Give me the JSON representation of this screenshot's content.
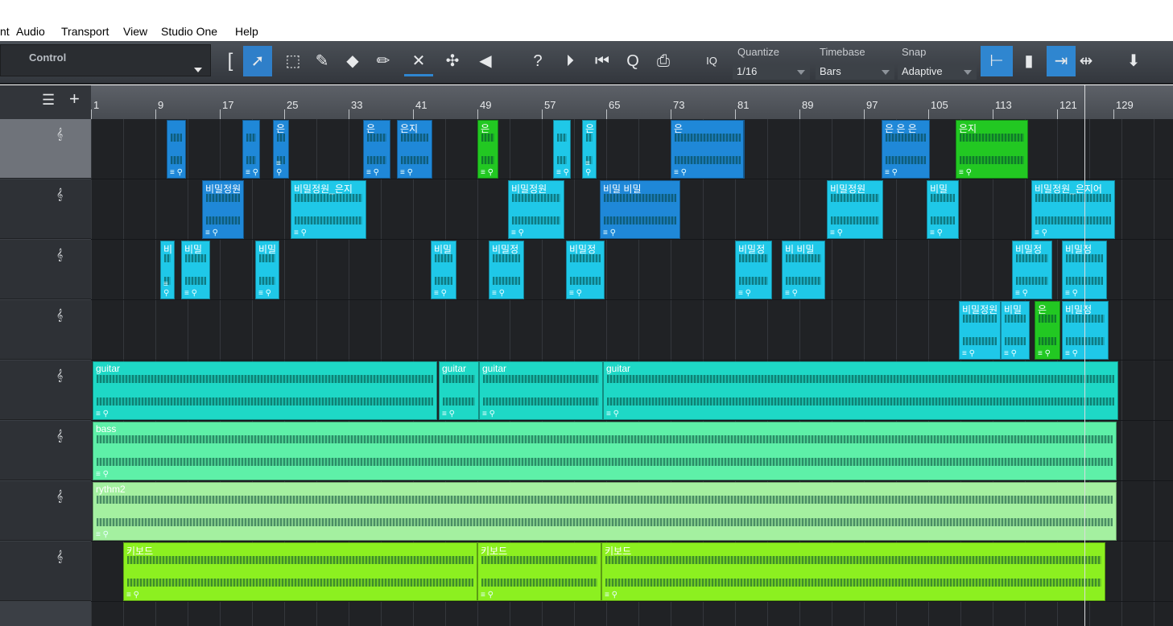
{
  "menu": [
    "nt",
    "Audio",
    "Transport",
    "View",
    "Studio One",
    "Help"
  ],
  "toolbar": {
    "control_label": "Control",
    "quantize_label": "Quantize",
    "quantize_value": "1/16",
    "timebase_label": "Timebase",
    "timebase_value": "Bars",
    "snap_label": "Snap",
    "snap_value": "Adaptive",
    "iq_label": "IQ",
    "question": "?",
    "q_label": "Q"
  },
  "ruler": [
    "1",
    "9",
    "17",
    "25",
    "33",
    "41",
    "49",
    "57",
    "65",
    "73",
    "81",
    "89",
    "97",
    "105",
    "113",
    "121",
    "129"
  ],
  "colors": {
    "blue": "#1f88d8",
    "cyan": "#1fc8e8",
    "guitar": "#1ed8c6",
    "bass": "#5ef0a8",
    "rythm": "#a4f0a0",
    "keyboard": "#8cf020",
    "green": "#22c822"
  },
  "tracks": [
    {
      "clips": [
        {
          "name": ""
        },
        {
          "name": ""
        },
        {
          "name": "은"
        },
        {
          "name": "은"
        },
        {
          "name": "은지"
        },
        {
          "name": "은"
        },
        {
          "name": ""
        },
        {
          "name": "은"
        },
        {
          "name": "은"
        },
        {
          "name": "은"
        },
        {
          "name": "은 은 은"
        },
        {
          "name": "은지"
        }
      ]
    },
    {
      "clips": [
        {
          "name": "비밀정원"
        },
        {
          "name": "비밀정원_은지"
        },
        {
          "name": "비밀정원"
        },
        {
          "name": "비밀 비밀"
        },
        {
          "name": "비밀정원"
        },
        {
          "name": "비밀"
        },
        {
          "name": "비밀정원_은지어"
        }
      ]
    },
    {
      "clips": [
        {
          "name": "비"
        },
        {
          "name": "비밀"
        },
        {
          "name": "비밀"
        },
        {
          "name": "비밀"
        },
        {
          "name": "비밀정"
        },
        {
          "name": "비밀정"
        },
        {
          "name": "비밀정"
        },
        {
          "name": "비 비밀"
        },
        {
          "name": "비밀정"
        },
        {
          "name": "비밀정"
        }
      ]
    },
    {
      "clips": [
        {
          "name": "비밀정원"
        },
        {
          "name": "비밀"
        },
        {
          "name": "은"
        },
        {
          "name": "비밀정"
        }
      ]
    },
    {
      "clips": [
        {
          "name": "guitar"
        },
        {
          "name": "guitar"
        },
        {
          "name": "guitar"
        },
        {
          "name": "guitar"
        }
      ]
    },
    {
      "clips": [
        {
          "name": "bass"
        }
      ]
    },
    {
      "clips": [
        {
          "name": "rythm2"
        }
      ]
    },
    {
      "clips": [
        {
          "name": "키보드"
        },
        {
          "name": "키보드"
        },
        {
          "name": "키보드"
        }
      ]
    }
  ]
}
